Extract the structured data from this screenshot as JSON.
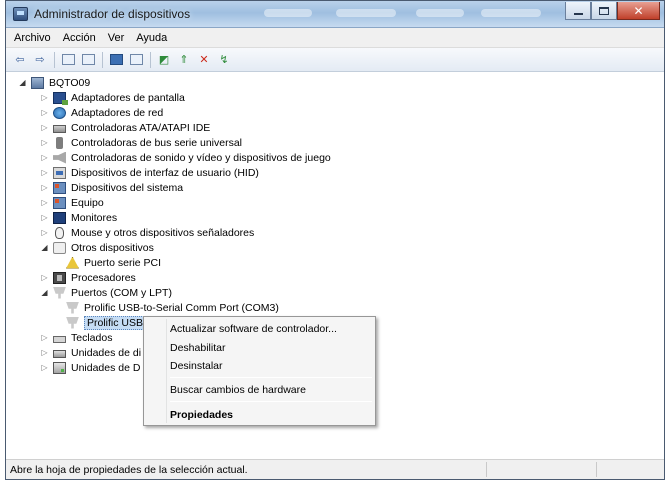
{
  "window": {
    "title": "Administrador de dispositivos"
  },
  "menubar": [
    "Archivo",
    "Acción",
    "Ver",
    "Ayuda"
  ],
  "tree": {
    "root": "BQTO09",
    "categories": [
      {
        "label": "Adaptadores de pantalla",
        "icon": "display-adapter-icon",
        "expanded": false
      },
      {
        "label": "Adaptadores de red",
        "icon": "network-adapter-icon",
        "expanded": false
      },
      {
        "label": "Controladoras ATA/ATAPI IDE",
        "icon": "ide-controller-icon",
        "expanded": false
      },
      {
        "label": "Controladoras de bus serie universal",
        "icon": "usb-icon",
        "expanded": false
      },
      {
        "label": "Controladoras de sonido y vídeo y dispositivos de juego",
        "icon": "sound-icon",
        "expanded": false
      },
      {
        "label": "Dispositivos de interfaz de usuario (HID)",
        "icon": "hid-icon",
        "expanded": false
      },
      {
        "label": "Dispositivos del sistema",
        "icon": "system-device-icon",
        "expanded": false
      },
      {
        "label": "Equipo",
        "icon": "computer-icon",
        "expanded": false
      },
      {
        "label": "Monitores",
        "icon": "monitor-icon",
        "expanded": false
      },
      {
        "label": "Mouse y otros dispositivos señaladores",
        "icon": "mouse-icon",
        "expanded": false
      },
      {
        "label": "Otros dispositivos",
        "icon": "other-devices-icon",
        "expanded": true
      },
      {
        "label": "Puerto serie PCI",
        "icon": "warning-device-icon",
        "child": true
      },
      {
        "label": "Procesadores",
        "icon": "processor-icon",
        "expanded": false
      },
      {
        "label": "Puertos (COM y LPT)",
        "icon": "port-icon",
        "expanded": true
      },
      {
        "label": "Prolific USB-to-Serial Comm Port (COM3)",
        "icon": "port-icon",
        "child": true
      },
      {
        "label": "Prolific USB",
        "icon": "port-icon",
        "child": true,
        "selected": true
      },
      {
        "label": "Teclados",
        "icon": "keyboard-icon",
        "expanded": false
      },
      {
        "label": "Unidades de di",
        "icon": "disk-icon",
        "expanded": false
      },
      {
        "label": "Unidades de D",
        "icon": "drive-icon",
        "expanded": false
      }
    ]
  },
  "context_menu": {
    "items": [
      "Actualizar software de controlador...",
      "Deshabilitar",
      "Desinstalar",
      "Buscar cambios de hardware",
      "Propiedades"
    ]
  },
  "statusbar": {
    "text": "Abre la hoja de propiedades de la selección actual."
  }
}
